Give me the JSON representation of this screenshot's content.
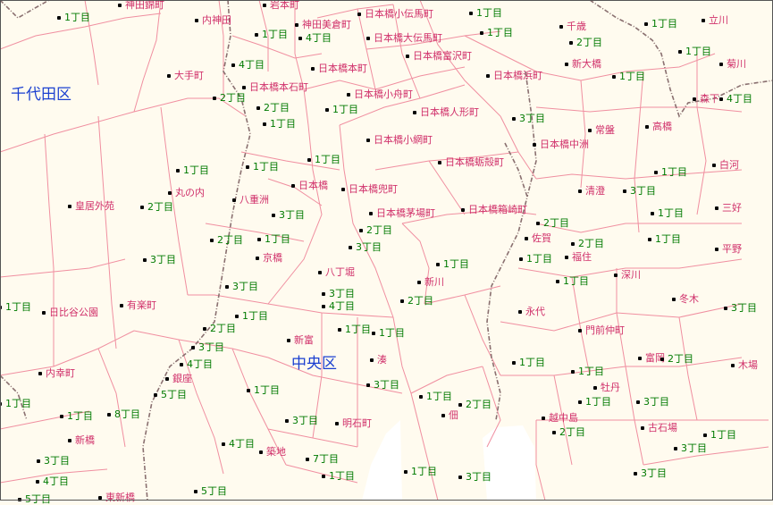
{
  "map": {
    "wards": [
      "千代田区",
      "中央区"
    ],
    "town_labels": [
      "神田錦町",
      "内神田",
      "岩本町",
      "神田美倉町",
      "日本橋小伝馬町",
      "日本橋大伝馬町",
      "日本橋富沢町",
      "大手町",
      "日本橋本石町",
      "日本橋本町",
      "日本橋小舟町",
      "日本橋浜町",
      "千歳",
      "新大橋",
      "立川",
      "菊川",
      "森下",
      "日本橋人形町",
      "常盤",
      "高橋",
      "日本橋中洲",
      "日本橋小網町",
      "日本橋蛎殻町",
      "白河",
      "日本橋",
      "日本橋兜町",
      "丸の内",
      "清澄",
      "皇居外苑",
      "八重洲",
      "日本橋茅場町",
      "日本橋箱崎町",
      "三好",
      "佐賀",
      "平野",
      "京橋",
      "福住",
      "深川",
      "八丁堀",
      "新川",
      "冬木",
      "日比谷公園",
      "有楽町",
      "永代",
      "門前仲町",
      "新富",
      "湊",
      "富岡",
      "内幸町",
      "銀座",
      "牡丹",
      "木場",
      "佃",
      "越中島",
      "古石場",
      "新橋",
      "明石町",
      "築地",
      "東新橋"
    ],
    "chome_labels": [
      "1丁目",
      "2丁目",
      "3丁目",
      "4丁目",
      "5丁目",
      "6丁目",
      "7丁目",
      "8丁目"
    ]
  }
}
